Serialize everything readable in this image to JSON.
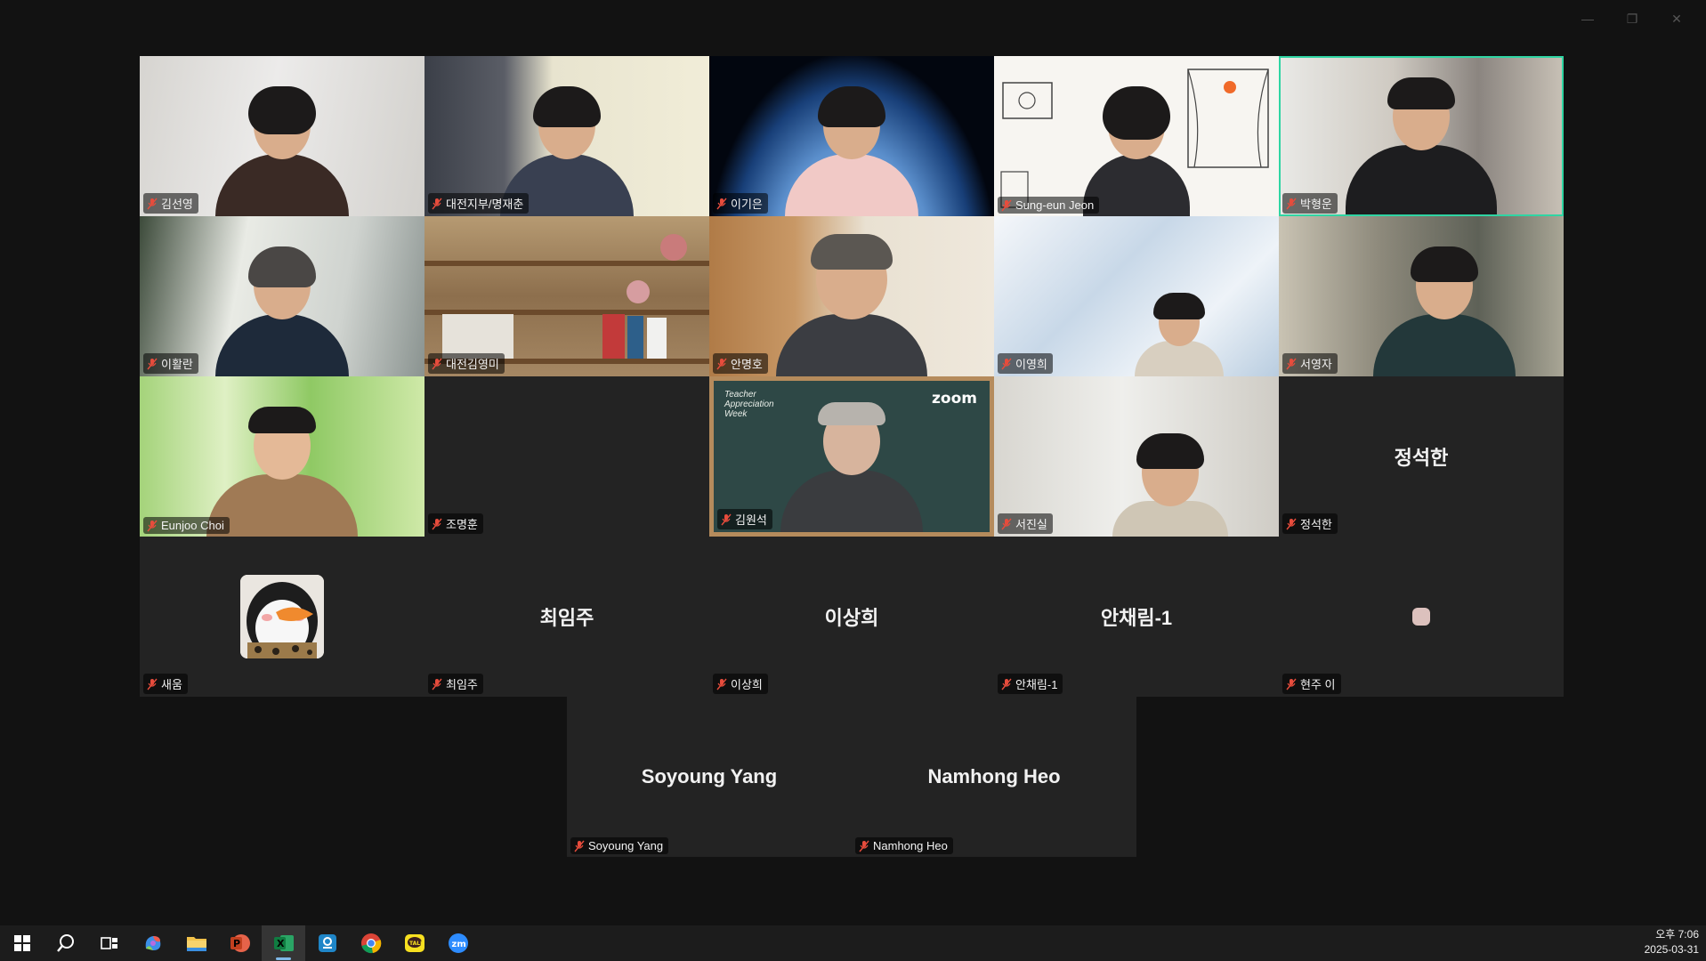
{
  "window": {
    "controls": [
      "minimize",
      "restore",
      "close"
    ]
  },
  "participants": [
    {
      "name": "김선영",
      "video": "on"
    },
    {
      "name": "대전지부/명재춘",
      "video": "on"
    },
    {
      "name": "이기은",
      "video": "on"
    },
    {
      "name": "Sung-eun Jeon",
      "video": "on"
    },
    {
      "name": "박형운",
      "video": "on",
      "active_speaker": true
    },
    {
      "name": "이활란",
      "video": "on"
    },
    {
      "name": "대전김영미",
      "video": "on"
    },
    {
      "name": "안명호",
      "video": "on"
    },
    {
      "name": "이영희",
      "video": "on"
    },
    {
      "name": "서영자",
      "video": "on"
    },
    {
      "name": "Eunjoo Choi",
      "video": "on"
    },
    {
      "name": "조명훈",
      "video": "off"
    },
    {
      "name": "김원석",
      "video": "on"
    },
    {
      "name": "서진실",
      "video": "on"
    },
    {
      "name": "정석한",
      "video": "off",
      "display_name": "정석한"
    },
    {
      "name": "새움",
      "video": "off",
      "avatar": "penguin-avatar"
    },
    {
      "name": "최임주",
      "video": "off",
      "display_name": "최임주"
    },
    {
      "name": "이상희",
      "video": "off",
      "display_name": "이상희"
    },
    {
      "name": "안채림-1",
      "video": "off",
      "display_name": "안채림-1"
    },
    {
      "name": "현주 이",
      "video": "off",
      "avatar": "small-pink-avatar"
    },
    {
      "name": "Soyoung Yang",
      "video": "off",
      "display_name": "Soyoung Yang"
    },
    {
      "name": "Namhong Heo",
      "video": "off",
      "display_name": "Namhong Heo"
    }
  ],
  "virtual_background": {
    "board_text": "Teacher\nAppreciation\nWeek",
    "logo": "zoom"
  },
  "taskbar": {
    "icons": [
      "windows-start-icon",
      "search-icon",
      "task-view-icon",
      "copilot-icon",
      "file-explorer-icon",
      "powerpoint-icon",
      "excel-icon",
      "hancom-icon",
      "chrome-icon",
      "kakaotalk-icon",
      "zoom-icon"
    ],
    "active_icon": "excel-icon",
    "clock_time": "오후 7:06",
    "clock_date": "2025-03-31"
  },
  "colors": {
    "active_speaker_border": "#2fd5a3",
    "muted_mic": "#e74c3c",
    "tile_background": "#232323"
  }
}
